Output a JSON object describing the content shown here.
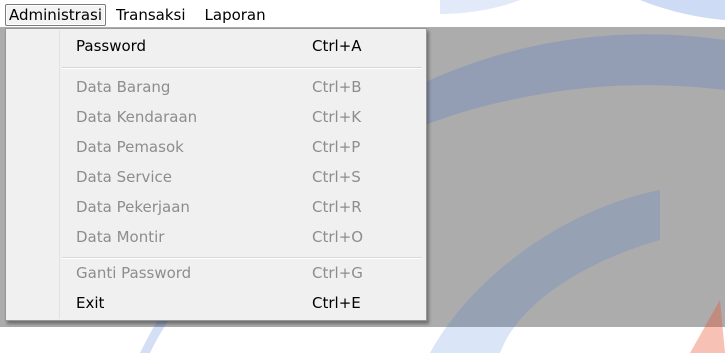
{
  "menubar": {
    "items": [
      {
        "label": "Administrasi"
      },
      {
        "label": "Transaksi"
      },
      {
        "label": "Laporan"
      }
    ]
  },
  "dropdown": {
    "items": [
      {
        "label": "Password",
        "shortcut": "Ctrl+A",
        "enabled": true
      },
      {
        "label": "Data Barang",
        "shortcut": "Ctrl+B",
        "enabled": false
      },
      {
        "label": "Data Kendaraan",
        "shortcut": "Ctrl+K",
        "enabled": false
      },
      {
        "label": "Data Pemasok",
        "shortcut": "Ctrl+P",
        "enabled": false
      },
      {
        "label": "Data Service",
        "shortcut": "Ctrl+S",
        "enabled": false
      },
      {
        "label": "Data Pekerjaan",
        "shortcut": "Ctrl+R",
        "enabled": false
      },
      {
        "label": "Data Montir",
        "shortcut": "Ctrl+O",
        "enabled": false
      },
      {
        "label": "Ganti Password",
        "shortcut": "Ctrl+G",
        "enabled": false
      },
      {
        "label": "Exit",
        "shortcut": "Ctrl+E",
        "enabled": true
      }
    ]
  },
  "colors": {
    "workspace": "#acacac",
    "menu_background": "#f0f0f0",
    "disabled_text": "#8d8d8d",
    "watermark": "#3a6fd8"
  }
}
